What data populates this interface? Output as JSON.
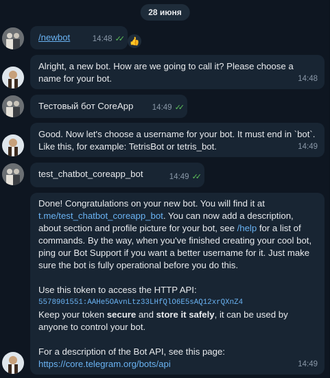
{
  "date_chip": "28 июня",
  "messages": [
    {
      "text": "/newbot",
      "time": "14:48",
      "read": true
    },
    {
      "text": "Alright, a new bot. How are we going to call it? Please choose a name for your bot.",
      "time": "14:48"
    },
    {
      "text": "Тестовый бот CoreApp",
      "time": "14:49",
      "read": true
    },
    {
      "text": "Good. Now let's choose a username for your bot. It must end in `bot`. Like this, for example: TetrisBot or tetris_bot.",
      "time": "14:49"
    },
    {
      "text": "test_chatbot_coreapp_bot",
      "time": "14:49",
      "read": true
    },
    {
      "time": "14:49",
      "p1_a": "Done! Congratulations on your new bot. You will find it at",
      "p1_link": "t.me/test_chatbot_coreapp_bot",
      "p1_b": ". You can now add a description, about section and profile picture for your bot, see ",
      "p1_help": "/help",
      "p1_c": " for a list of commands. By the way, when you've finished creating your cool bot, ping our Bot Support if you want a better username for it. Just make sure the bot is fully operational before you do this.",
      "p2_label": "Use this token to access the HTTP API:",
      "p2_token": "5578901551:AAHe5OAvnLtz33LHfQlO6E5sAQ12xrQXnZ4",
      "p3_a": "Keep your token ",
      "p3_secure": "secure",
      "p3_b": " and ",
      "p3_safe": "store it safely",
      "p3_c": ", it can be used by anyone to control your bot.",
      "p4_label": "For a description of the Bot API, see this page:",
      "p4_link": "https://core.telegram.org/bots/api"
    }
  ],
  "reaction": "👍",
  "ticks": "✓✓",
  "colors": {
    "background": "#0e1621",
    "bubble_incoming": "#182533",
    "bubble_outgoing_user": "#182533",
    "link": "#6ab3f3",
    "read_ticks": "#5ec45a"
  }
}
